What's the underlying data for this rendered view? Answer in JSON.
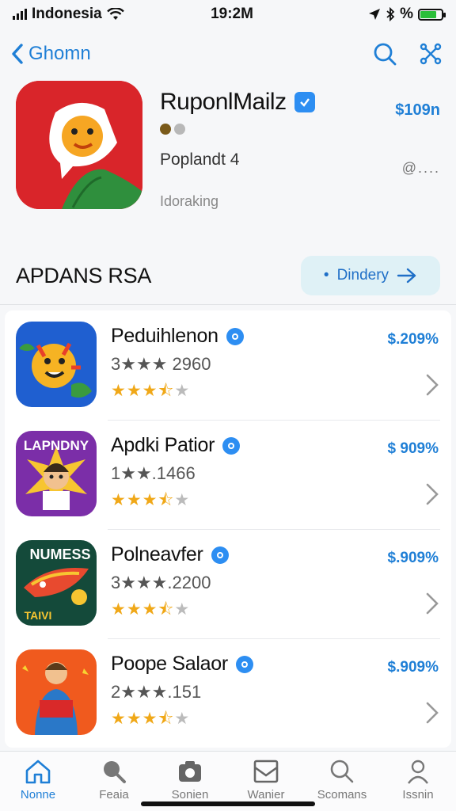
{
  "status_bar": {
    "carrier": "Indonesia",
    "time": "19:2M",
    "battery_text": "%"
  },
  "nav": {
    "back_label": "Ghomn"
  },
  "featured": {
    "title": "RuponlMailz",
    "price": "$109n",
    "subtitle": "Poplandt 4",
    "more": "@....",
    "status": "Idoraking"
  },
  "section": {
    "title": "APDANS RSA",
    "button_label": "Dindery"
  },
  "apps": [
    {
      "name": "Peduihlenon",
      "meta": "3★★★ 2960",
      "rating": 3.5,
      "price": "$.209%"
    },
    {
      "name": "Apdki Patior",
      "meta": "1★★.1466",
      "rating": 3.5,
      "price": "$ 909%"
    },
    {
      "name": "Polneavfer",
      "meta": "3★★★.2200",
      "rating": 3.5,
      "price": "$.909%"
    },
    {
      "name": "Poope Salaor",
      "meta": "2★★★.151",
      "rating": 3.5,
      "price": "$.909%"
    }
  ],
  "icon_text": {
    "app2": "LAPNDNY",
    "app3_top": "NUMESS",
    "app3_bottom": "TAIVI"
  },
  "tabs": [
    {
      "label": "Nonne",
      "icon": "home-icon",
      "active": true
    },
    {
      "label": "Feaia",
      "icon": "search-icon",
      "active": false
    },
    {
      "label": "Sonien",
      "icon": "camera-icon",
      "active": false
    },
    {
      "label": "Wanier",
      "icon": "inbox-icon",
      "active": false
    },
    {
      "label": "Scomans",
      "icon": "magnifier-icon",
      "active": false
    },
    {
      "label": "Issnin",
      "icon": "person-icon",
      "active": false
    }
  ],
  "colors": {
    "accent": "#1f7fd6",
    "star": "#f0a818",
    "featured_icon_bg": "#d9252a"
  }
}
